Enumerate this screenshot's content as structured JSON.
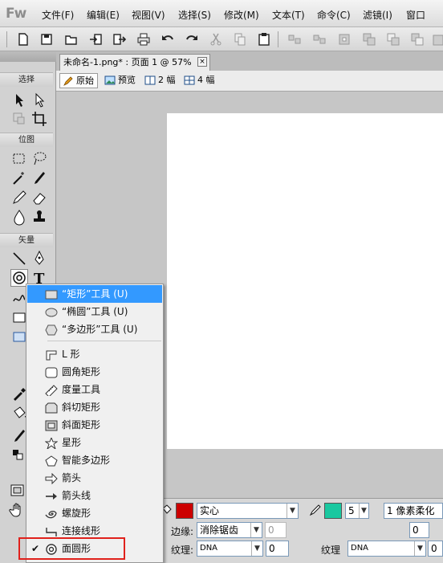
{
  "app": {
    "logo": "Fw"
  },
  "menubar": {
    "items": [
      "文件(F)",
      "编辑(E)",
      "视图(V)",
      "选择(S)",
      "修改(M)",
      "文本(T)",
      "命令(C)",
      "滤镜(I)",
      "窗口"
    ]
  },
  "toolbar": {
    "buttons": [
      "new-icon",
      "save-icon",
      "open-icon",
      "import-icon",
      "export-icon",
      "print-icon",
      "undo-icon",
      "redo-icon",
      "cut-icon",
      "copy-icon",
      "paste-icon",
      "group-icon",
      "ungroup-icon",
      "combine-icon",
      "union-icon",
      "intersect-icon",
      "punch-icon",
      "crop-icon"
    ]
  },
  "tools": {
    "sections": {
      "select": "选择",
      "bitmap": "位图",
      "vector": "矢量"
    }
  },
  "document": {
    "tab_title": "未命名-1.png* : 页面 1 @ 57%",
    "close": "×"
  },
  "viewbar": {
    "original": "原始",
    "preview": "预览",
    "two_up": "2 幅",
    "four_up": "4 幅"
  },
  "flyout": {
    "items": [
      {
        "label": "“矩形”工具 (U)",
        "icon": "rectangle-icon"
      },
      {
        "label": "“椭圆”工具 (U)",
        "icon": "ellipse-icon"
      },
      {
        "label": "“多边形”工具 (U)",
        "icon": "polygon-icon"
      },
      {
        "label": "L 形",
        "icon": "l-shape-icon"
      },
      {
        "label": "圆角矩形",
        "icon": "rounded-rectangle-icon"
      },
      {
        "label": "度量工具",
        "icon": "measure-icon"
      },
      {
        "label": "斜切矩形",
        "icon": "chamfer-rectangle-icon"
      },
      {
        "label": "斜面矩形",
        "icon": "bevel-rectangle-icon"
      },
      {
        "label": "星形",
        "icon": "star-icon"
      },
      {
        "label": "智能多边形",
        "icon": "smart-polygon-icon"
      },
      {
        "label": "箭头",
        "icon": "arrow-icon"
      },
      {
        "label": "箭头线",
        "icon": "arrow-line-icon"
      },
      {
        "label": "螺旋形",
        "icon": "spiral-icon"
      },
      {
        "label": "连接线形",
        "icon": "connector-icon"
      },
      {
        "label": "面圆形",
        "icon": "doughnut-icon"
      }
    ],
    "checked_item": "面圆形",
    "highlighted_item": "“矩形”工具 (U)"
  },
  "properties": {
    "fill_type": "实心",
    "edge_label": "边缘:",
    "edge_value": "消除锯齿",
    "edge_amount": "0",
    "texture_label": "纹理:",
    "texture_value": "DNA",
    "texture_amount": "0",
    "stroke_size": "5",
    "stroke_type": "1 像素柔化",
    "stroke_texture_label": "纹理",
    "stroke_texture_value": "DNA",
    "stroke_texture_amount": "0",
    "edge2_amount": "0",
    "fill_color": "#cc0000",
    "stroke_color": "#19c8a0"
  }
}
